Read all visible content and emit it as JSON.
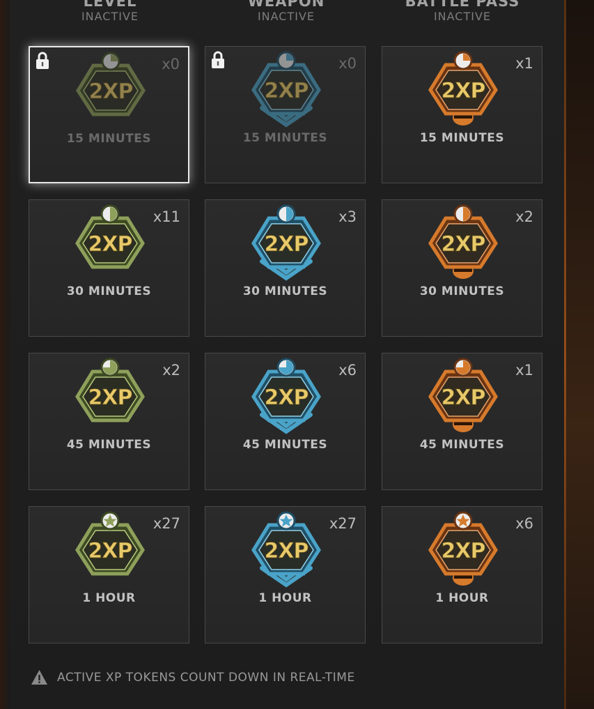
{
  "columns": [
    {
      "title": "LEVEL",
      "status": "INACTIVE",
      "color": "#8ea05a"
    },
    {
      "title": "WEAPON",
      "status": "INACTIVE",
      "color": "#4aa3c8"
    },
    {
      "title": "BATTLE PASS",
      "status": "INACTIVE",
      "color": "#d67a2c"
    }
  ],
  "tokens": [
    [
      {
        "label": "2XP",
        "duration": "15 MINUTES",
        "count": "x0",
        "locked": true,
        "selected": true
      },
      {
        "label": "2XP",
        "duration": "30 MINUTES",
        "count": "x11"
      },
      {
        "label": "2XP",
        "duration": "45 MINUTES",
        "count": "x2"
      },
      {
        "label": "2XP",
        "duration": "1 HOUR",
        "count": "x27"
      }
    ],
    [
      {
        "label": "2XP",
        "duration": "15 MINUTES",
        "count": "x0",
        "locked": true
      },
      {
        "label": "2XP",
        "duration": "30 MINUTES",
        "count": "x3"
      },
      {
        "label": "2XP",
        "duration": "45 MINUTES",
        "count": "x6"
      },
      {
        "label": "2XP",
        "duration": "1 HOUR",
        "count": "x27"
      }
    ],
    [
      {
        "label": "2XP",
        "duration": "15 MINUTES",
        "count": "x1"
      },
      {
        "label": "2XP",
        "duration": "30 MINUTES",
        "count": "x2"
      },
      {
        "label": "2XP",
        "duration": "45 MINUTES",
        "count": "x1"
      },
      {
        "label": "2XP",
        "duration": "1 HOUR",
        "count": "x6"
      }
    ]
  ],
  "footer": {
    "text": "ACTIVE XP TOKENS COUNT DOWN IN REAL-TIME",
    "icon": "warning-icon"
  }
}
